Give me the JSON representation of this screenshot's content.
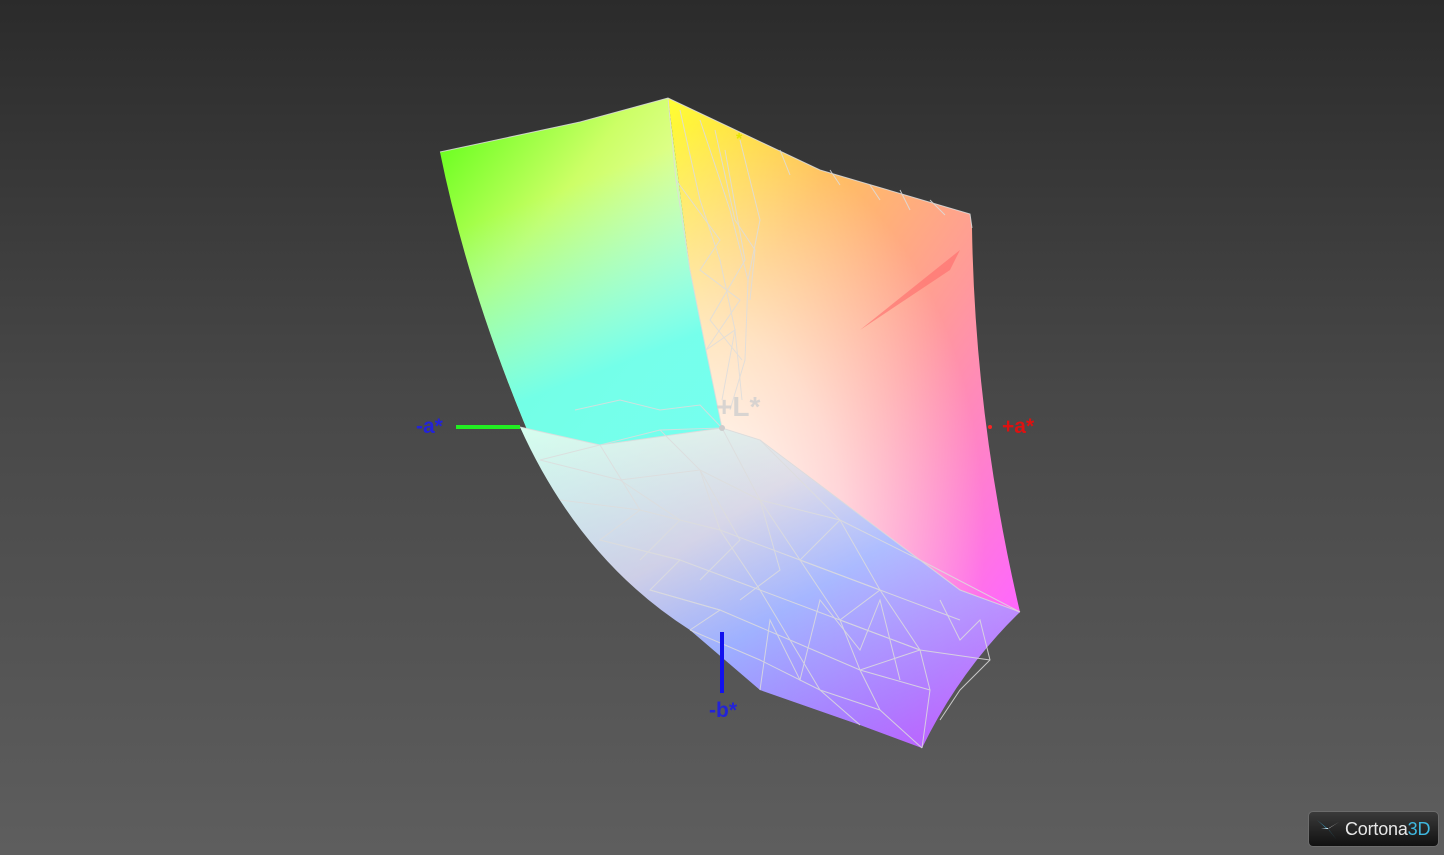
{
  "viewer": {
    "axes": {
      "neg_a": {
        "label": "-a*",
        "color": "#2323d8"
      },
      "pos_a": {
        "label": "+a*",
        "color": "#dd1111"
      },
      "neg_b": {
        "label": "-b*",
        "color": "#2323d8"
      },
      "pos_l": {
        "label": "+L*",
        "color": "#cfcfcf"
      },
      "a_axis_color": "#22ee22",
      "b_axis_color": "#1111ee",
      "yellow_marker": {
        "label": "*",
        "color": "#e6e600"
      }
    },
    "colors": {
      "green": "#55ff11",
      "yellow": "#ffff00",
      "orange": "#ff8a40",
      "red": "#ff5050",
      "cyan": "#66ffee",
      "magenta": "#ff33ff",
      "blue": "#7a8cff",
      "violet": "#bb55ff",
      "wireframe": "#dddddd"
    }
  },
  "brand": {
    "name": "Cortona",
    "suffix": "3D"
  }
}
